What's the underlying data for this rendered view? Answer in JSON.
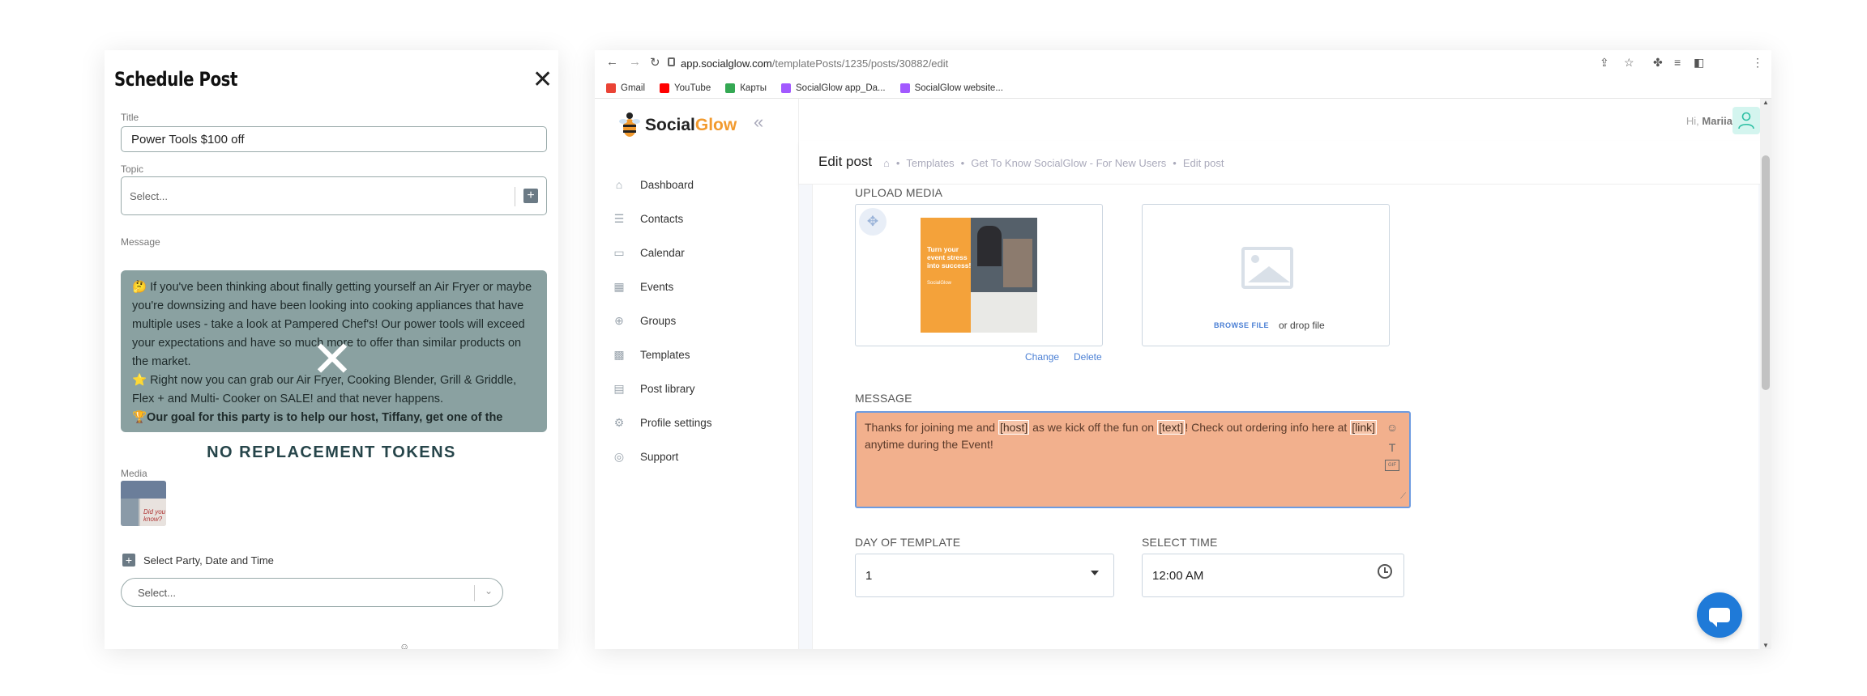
{
  "schedule_post": {
    "title": "Schedule Post",
    "close_glyph": "✕",
    "title_label": "Title",
    "title_value": "Power Tools $100 off",
    "topic_label": "Topic",
    "topic_placeholder": "Select...",
    "message_label": "Message",
    "message_lines": [
      "🤔 If you've been thinking about finally getting yourself an Air Fryer or maybe you're downsizing and have been looking into cooking appliances that have multiple uses - take a look at Pampered Chef's! Our power tools will exceed your expectations and have so much more to offer than similar products on the market.",
      "⭐ Right now you can grab our Air Fryer, Cooking Blender, Grill & Griddle, Flex + and Multi- Cooker on SALE! and that never happens."
    ],
    "message_bold_line": "🏆Our goal for this party is to help our host, Tiffany, get one of the power",
    "no_tokens": "NO REPLACEMENT TOKENS",
    "media_label": "Media",
    "media_thumb_text": "Did you know?",
    "party_label": "Select Party, Date and Time",
    "party_placeholder": "Select..."
  },
  "browser": {
    "url_host": "app.socialglow.com",
    "url_path": "/templatePosts/1235/posts/30882/edit",
    "bookmarks": [
      {
        "label": "Gmail",
        "color": "#ea4335"
      },
      {
        "label": "YouTube",
        "color": "#ff0000"
      },
      {
        "label": "Карты",
        "color": "#34a853"
      },
      {
        "label": "SocialGlow app_Da...",
        "color": "#a259ff"
      },
      {
        "label": "SocialGlow website...",
        "color": "#a259ff"
      }
    ]
  },
  "app": {
    "brand_prefix": "Social",
    "brand_suffix": "Glow",
    "greeting_prefix": "Hi,",
    "user_name": "Mariia",
    "nav": [
      {
        "label": "Dashboard",
        "icon": "home-icon",
        "glyph": "⌂"
      },
      {
        "label": "Contacts",
        "icon": "contacts-icon",
        "glyph": "☰"
      },
      {
        "label": "Calendar",
        "icon": "calendar-icon",
        "glyph": "▭"
      },
      {
        "label": "Events",
        "icon": "events-icon",
        "glyph": "▦"
      },
      {
        "label": "Groups",
        "icon": "groups-icon",
        "glyph": "⊕"
      },
      {
        "label": "Templates",
        "icon": "templates-icon",
        "glyph": "▩"
      },
      {
        "label": "Post library",
        "icon": "post-library-icon",
        "glyph": "▤"
      },
      {
        "label": "Profile settings",
        "icon": "settings-icon",
        "glyph": "⚙"
      },
      {
        "label": "Support",
        "icon": "support-icon",
        "glyph": "◎"
      }
    ],
    "page_title": "Edit post",
    "breadcrumbs": [
      "Templates",
      "Get To Know SocialGlow - For New Users",
      "Edit post"
    ],
    "upload_label": "UPLOAD MEDIA",
    "promo_text": "Turn your event stress into success!",
    "promo_brand": "SocialGlow",
    "change_label": "Change",
    "delete_label": "Delete",
    "browse_label": "BROWSE FILE",
    "drop_label": "or drop file",
    "message_label": "MESSAGE",
    "message_parts": {
      "p1": "Thanks for joining me and ",
      "t1": "[host]",
      "p2": " as we kick off the fun on ",
      "t2": "[text]",
      "p3": "! Check out ordering info here at ",
      "t3": "[link]",
      "p4": " anytime during the Event!"
    },
    "day_label": "DAY OF TEMPLATE",
    "day_value": "1",
    "time_label": "SELECT TIME",
    "time_value": "12:00 AM"
  }
}
